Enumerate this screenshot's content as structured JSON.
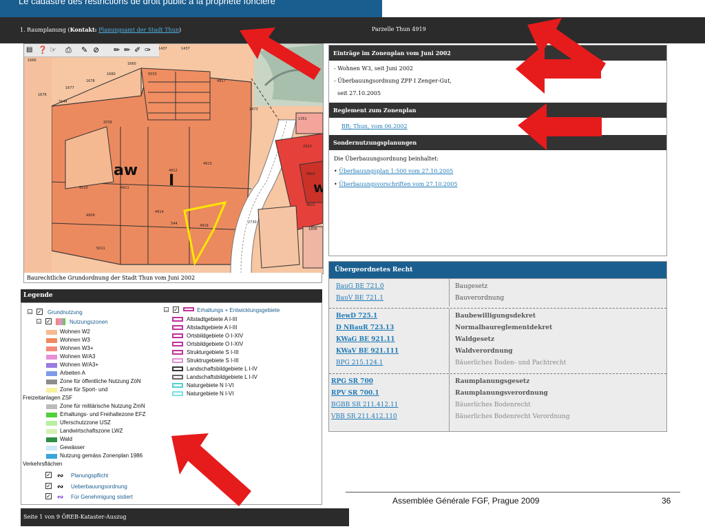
{
  "header": {
    "title": "Le cadastre des restrictions de droit public à la propriété foncière",
    "left_prefix": "1. Raumplanung (",
    "left_contact_label": "Kontakt:",
    "left_contact_link": "Planungsamt der Stadt Thun",
    "left_suffix": ")",
    "parcel": "Parzelle Thun 4919"
  },
  "map": {
    "caption": "Baurechtliche Grundordnung der Stadt Thun vom Juni 2002",
    "zone_label_1": "aw",
    "zone_label_2": "I",
    "zone_label_3": "w",
    "parcels": [
      "1666",
      "1660",
      "1437",
      "1437",
      "1680",
      "1678",
      "1677",
      "1676",
      "3144",
      "2039",
      "5033",
      "4917",
      "5010",
      "4911",
      "4912",
      "4913",
      "4909",
      "4914",
      "5011",
      "544",
      "4919",
      "2730",
      "1473",
      "1351",
      "2923",
      "1806",
      "4923",
      "4922"
    ]
  },
  "toolbar": {
    "icons": [
      "layers-icon",
      "help-icon",
      "identify-icon",
      "print-icon",
      "measure-icon",
      "clear-icon",
      "draw-line-icon",
      "draw-line-icon-2",
      "draw-polygon-icon",
      "draw-point-icon"
    ]
  },
  "zonenplan": {
    "header": "Einträge im Zonenplan vom Juni 2002",
    "lines": [
      "- Wohnen W3, seit Juni 2002",
      "- Überbauungsordnung ZPP I Zenger-Gut,",
      "  seit 27.10.2005"
    ],
    "reglement_header": "Reglement zum Zonenplan",
    "reglement_link": "BR; Thun, vom 06.2002",
    "sonder_header": "Sondernutzungsplanungen",
    "sonder_intro": "Die Überbauungsordnung beinhaltet:",
    "sonder_links": [
      "Überbauungsplan 1:500 vom 27.10.2005",
      "Überbauungsvorschriften vom 27.10.2005"
    ]
  },
  "recht": {
    "header": "Übergeordnetes Recht",
    "groups": [
      {
        "left": [
          "BauG BE 721.0",
          "BauV BE 721.1"
        ],
        "right": [
          "Baugesetz",
          "Bauverordnung"
        ]
      },
      {
        "left": [
          "BewD 725.1",
          "D NBauR 723.13",
          "KWaG BE 921.11",
          "KWaV BE 921.111",
          "BPG 215.124.1"
        ],
        "right": [
          "Baubewilligungsdekret",
          "Normalbaureglementdekret",
          "Waldgesetz",
          "Waldverordnung",
          "Bäuerliches Boden- und Pachtrecht"
        ]
      },
      {
        "left": [
          "RPG SR 700",
          "RPV SR 700.1",
          "BGBB SR 211.412.11",
          "VBB SR 211.412.110"
        ],
        "right": [
          "Raumplanungsgesetz",
          "Raumplanungsverordnung",
          "Bäuerliches Bodenrecht",
          "Bäuerliches Bodenrecht Verordnung"
        ]
      }
    ]
  },
  "legend": {
    "header": "Legende",
    "grundnutzung": "Grundnutzung",
    "nutzungszonen": "Nutzungszonen",
    "zones": [
      {
        "label": "Wohnen W2",
        "color": "#f7b98e"
      },
      {
        "label": "Wohnen W3",
        "color": "#f08a5d"
      },
      {
        "label": "Wohnen W3+",
        "color": "#f38b7a"
      },
      {
        "label": "Wohnen W/A3",
        "color": "#e88fd8"
      },
      {
        "label": "Wohnen W/A3+",
        "color": "#9a7be0"
      },
      {
        "label": "Arbeiten A",
        "color": "#7f9ae8"
      },
      {
        "label": "Zone für öffentliche Nutzung ZöN",
        "color": "#8c8c8c"
      },
      {
        "label": "Zone für Sport- und",
        "color": "#f8f29a"
      },
      {
        "label": "Freizeitanlagen ZSF",
        "color": ""
      },
      {
        "label": "Zone für militärische Nutzung ZmN",
        "color": "#bcbcbc"
      },
      {
        "label": "Erhaltungs- und Freihaltezone EFZ",
        "color": "#4fcf3a"
      },
      {
        "label": "Uferschutzzone USZ",
        "color": "#b9ef9f"
      },
      {
        "label": "Landwirtschaftszone LWZ",
        "color": "#d8efb4"
      },
      {
        "label": "Wald",
        "color": "#2f8f43"
      },
      {
        "label": "Gewässer",
        "color": "#cfe9f6"
      },
      {
        "label": "Nutzung gemäss Zonenplan 1986",
        "color": "#3aa6d9"
      },
      {
        "label": "Verkehrsflächen",
        "color": ""
      }
    ],
    "planungspflicht": "Planungspflicht",
    "ueberbauungsordnung": "Ueberbauungsordnung",
    "genehmigung": "Für Genehmigung sistiert",
    "erhaltung_title": "Erhaltungs + Entwicklungsgebiete",
    "erhaltung": [
      {
        "label": "Altstadtgebiete A I-III",
        "color": "#c0309a"
      },
      {
        "label": "Altstadtgebiete A I-III",
        "color": "#c0309a"
      },
      {
        "label": "Ortsbildgebiete O I-XIV",
        "color": "#c0309a"
      },
      {
        "label": "Ortsbildgebiete O I-XIV",
        "color": "#c0309a"
      },
      {
        "label": "Strukturgebiete S I-III",
        "color": "#c0309a"
      },
      {
        "label": "Struktrugebiete S I-III",
        "color": "#e08fd2"
      },
      {
        "label": "Landschaftsbildgebiete L I-IV",
        "color": "#333333"
      },
      {
        "label": "Landschaftsbildgebiete L I-IV",
        "color": "#666666"
      },
      {
        "label": "Naturgebiete N I-VI",
        "color": "#4fd0d0"
      },
      {
        "label": "Naturgebiete N I-VI",
        "color": "#7fe0e0"
      }
    ]
  },
  "footer": {
    "conference": "Assemblée Générale FGF, Prague 2009",
    "page": "36",
    "bar": "Seite 1 von 9    ÖREB-Kataster-Auszug"
  },
  "colors": {
    "header_blue": "#1a5e8f",
    "dark_bar": "#2b2b2b",
    "arrow_red": "#e61b1b",
    "link": "#1f7ab8"
  }
}
